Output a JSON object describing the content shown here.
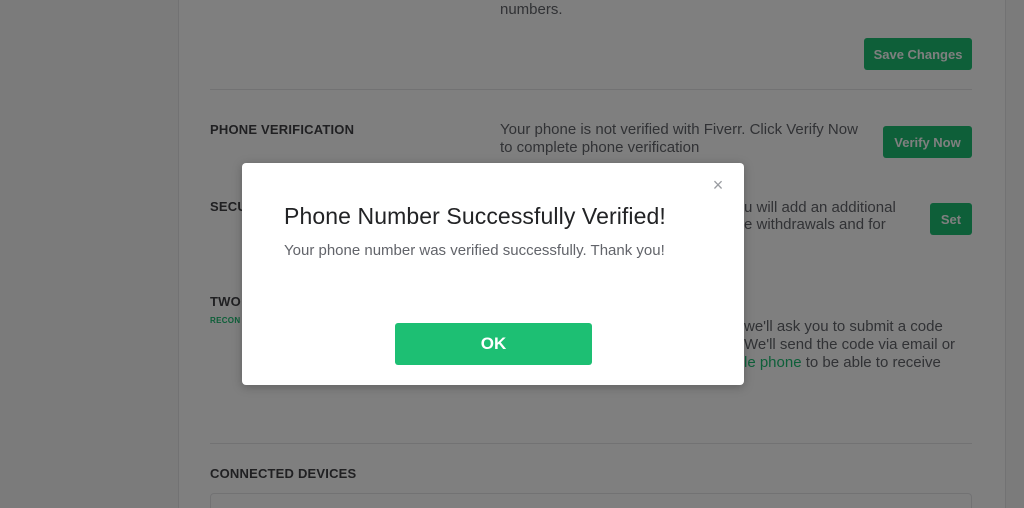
{
  "page": {
    "top_text": "numbers.",
    "save_changes_button": "Save Changes",
    "phone_verification": {
      "title": "PHONE VERIFICATION",
      "description_line1": "Your phone is not verified with Fiverr. Click Verify Now",
      "description_line2": "to complete phone verification",
      "button": "Verify Now"
    },
    "security_question": {
      "title_partial": "SECU",
      "description_line1_partial": "u will add an additional",
      "description_line2_partial": "e withdrawals and for",
      "button": "Set"
    },
    "two_factor": {
      "title_partial": "TWO",
      "subtitle_partial": "RECON",
      "line1_partial": "we'll ask you to submit a code",
      "line2_partial": "We'll send the code via email or",
      "line3_link_partial": "le phone",
      "line3_rest": "to be able to receive"
    },
    "connected_devices": {
      "title": "CONNECTED DEVICES"
    }
  },
  "modal": {
    "close_glyph": "×",
    "title": "Phone Number Successfully Verified!",
    "body": "Your phone number was verified successfully. Thank you!",
    "ok_button": "OK"
  },
  "colors": {
    "brand_green": "#1dbf73",
    "overlay": "rgba(0,0,0,0.5)"
  }
}
